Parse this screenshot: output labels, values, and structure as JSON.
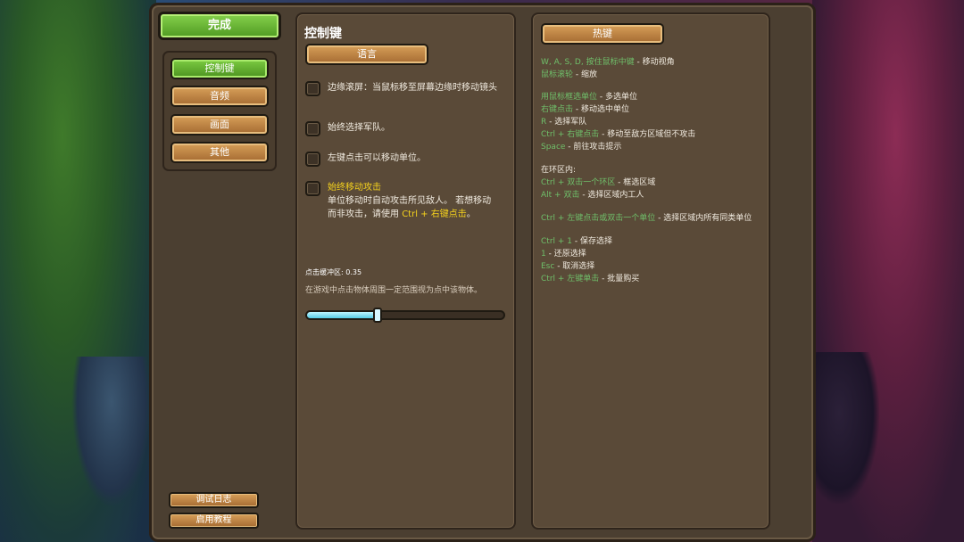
{
  "nav": {
    "done_label": "完成",
    "items": [
      {
        "label": "控制键",
        "active": true
      },
      {
        "label": "音频",
        "active": false
      },
      {
        "label": "画面",
        "active": false
      },
      {
        "label": "其他",
        "active": false
      }
    ],
    "debug_log_label": "调试日志",
    "tutorial_label": "启用教程"
  },
  "controls": {
    "title": "控制键",
    "language_label": "语言",
    "options": [
      {
        "text": "边缘滚屏：当鼠标移至屏幕边缘时移动镜头",
        "checked": false
      },
      {
        "text": "始终选择军队。",
        "checked": false
      },
      {
        "text": "左键点击可以移动单位。",
        "checked": false
      },
      {
        "title": "始终移动攻击",
        "desc_line1": "单位移动时自动攻击所见敌人。 若想移动",
        "desc_line2_a": "而非攻击，请使用 ",
        "desc_line2_b": "Ctrl + 右键点击",
        "desc_line2_c": "。",
        "checked": false
      }
    ],
    "slider_label": "点击缓冲区: 0.35",
    "slider_desc": "在游戏中点击物体周围一定范围视为点中该物体。",
    "slider_value": 0.35
  },
  "hotkeys": {
    "title": "热键",
    "lines": [
      {
        "key": "W, A, S, D, 按住鼠标中键",
        "desc": " - 移动视角"
      },
      {
        "key": "鼠标滚轮",
        "desc": " - 缩放"
      },
      {
        "key": "用鼠标框选单位",
        "desc": " - 多选单位"
      },
      {
        "key": "右键点击",
        "desc": " - 移动选中单位"
      },
      {
        "key": "R",
        "desc": " - 选择军队"
      },
      {
        "key": "Ctrl + 右键点击",
        "desc": " - 移动至敌方区域但不攻击"
      },
      {
        "key": "Space",
        "desc": " - 前往攻击提示"
      },
      {
        "key": "",
        "desc": "在环区内:"
      },
      {
        "key": "Ctrl + 双击一个环区",
        "desc": " - 框选区域"
      },
      {
        "key": "Alt + 双击",
        "desc": " - 选择区域内工人"
      },
      {
        "key": "Ctrl + 左键点击或双击一个单位",
        "desc": " - 选择区域内所有同类单位"
      },
      {
        "key": "Ctrl + 1",
        "desc": " - 保存选择"
      },
      {
        "key": "1",
        "desc": " - 还原选择"
      },
      {
        "key": "Esc",
        "desc": " - 取消选择"
      },
      {
        "key": "Ctrl + 左键单击",
        "desc": " - 批量购买"
      }
    ]
  }
}
